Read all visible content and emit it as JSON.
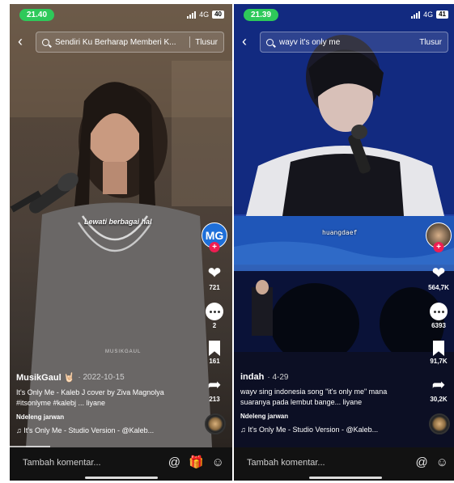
{
  "left": {
    "status": {
      "time": "21.40",
      "network": "4G",
      "battery": "40"
    },
    "search": {
      "query": "Sendiri Ku Berharap Memberi K...",
      "button": "Tlusur"
    },
    "overlay_text": "Lewati berbagai hal",
    "watermark": "MUSIKGAUL",
    "avatar": {
      "text": "MG",
      "color": "#1e6fd9"
    },
    "actions": {
      "likes": "721",
      "comments": "2",
      "saves": "161",
      "shares": "213"
    },
    "user": "MusikGaul 🤘🏻",
    "date": "· 2022-10-15",
    "description": "It's Only Me - Kaleb J cover by Ziva Magnolya #itsonlyme #kalebj ... liyane",
    "translate": "Ndeleng jarwan",
    "music": "♫ It's Only Me - Studio Version - @Kaleb...",
    "comment_placeholder": "Tambah komentar...",
    "progress": 0.18
  },
  "right": {
    "status": {
      "time": "21.39",
      "network": "4G",
      "battery": "41"
    },
    "search": {
      "query": "wayv it's only me",
      "button": "Tlusur"
    },
    "caption": "huangdaef",
    "actions": {
      "likes": "564,7K",
      "comments": "6393",
      "saves": "91,7K",
      "shares": "30,2K"
    },
    "user": "indah",
    "date": "· 4-29",
    "description": "wayv sing indonesia song \"it's only me\" mana suaranya pada lembut bange... liyane",
    "translate": "Ndeleng jarwan",
    "music": "♫ It's Only Me - Studio Version - @Kaleb...",
    "comment_placeholder": "Tambah komentar..."
  },
  "colors": {
    "time_pill": "#2ec95a",
    "plus": "#ee1d52",
    "bottombar": "#121212"
  },
  "icons": [
    "back-icon",
    "search-icon",
    "heart-icon",
    "comment-icon",
    "bookmark-icon",
    "share-icon",
    "at-icon",
    "gift-icon",
    "emoji-icon"
  ]
}
